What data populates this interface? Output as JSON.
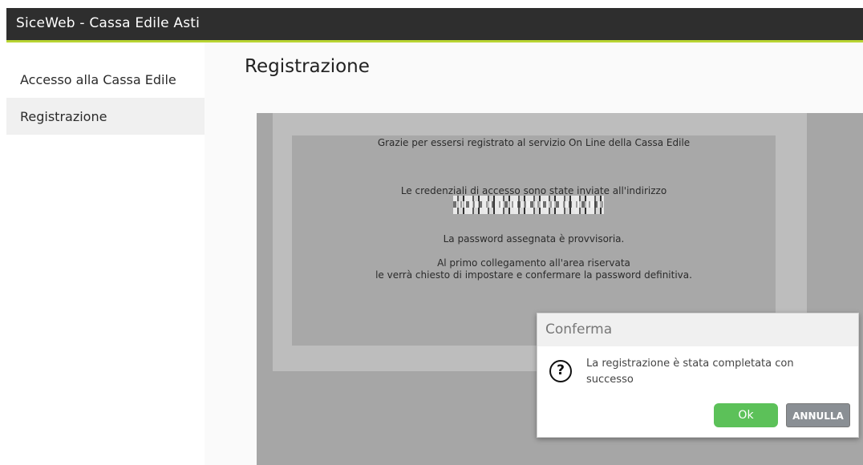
{
  "header": {
    "app_title": "SiceWeb - Cassa Edile Asti"
  },
  "sidebar": {
    "items": [
      {
        "label": "Accesso alla Cassa Edile",
        "active": false
      },
      {
        "label": "Registrazione",
        "active": true
      }
    ]
  },
  "main": {
    "title": "Registrazione",
    "message": {
      "thanks": "Grazie per essersi registrato al servizio On Line della Cassa Edile",
      "credentials": "Le credenziali di accesso sono state inviate all'indirizzo",
      "password_temp": "La password assegnata è provvisoria.",
      "first_login_1": "Al primo collegamento all'area riservata",
      "first_login_2": "le verrà chiesto di impostare e confermare la password definitiva."
    }
  },
  "dialog": {
    "title": "Conferma",
    "icon": "question-circle-icon",
    "message": "La registrazione è stata completata con successo",
    "ok_label": "Ok",
    "cancel_label": "ANNULLA"
  },
  "colors": {
    "topbar": "#2e2e2e",
    "accent_line": "#b8d432",
    "ok_button": "#5cc159",
    "cancel_button": "#8a8f94",
    "overlay": "#a6a6a6"
  }
}
